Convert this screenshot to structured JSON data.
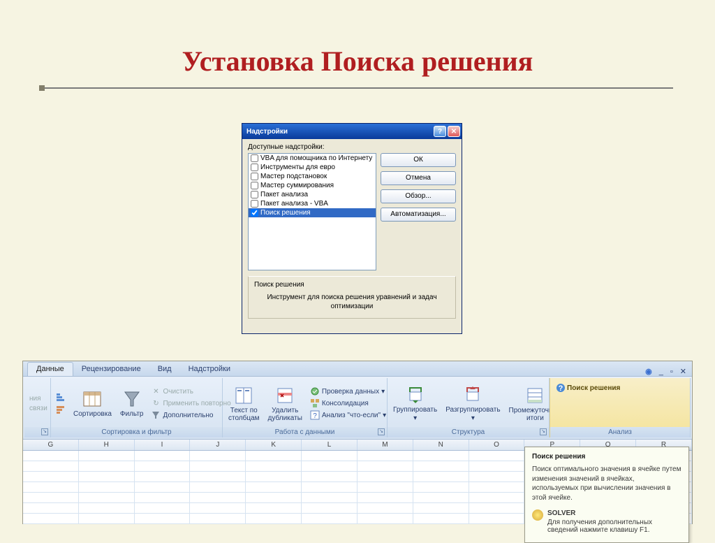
{
  "slide": {
    "title": "Установка Поиска решения"
  },
  "dialog": {
    "title": "Надстройки",
    "available_label": "Доступные надстройки:",
    "addins": [
      {
        "name": "VBA для помощника по Интернету",
        "checked": false
      },
      {
        "name": "Инструменты для евро",
        "checked": false
      },
      {
        "name": "Мастер подстановок",
        "checked": false
      },
      {
        "name": "Мастер суммирования",
        "checked": false
      },
      {
        "name": "Пакет анализа",
        "checked": false
      },
      {
        "name": "Пакет анализа - VBA",
        "checked": false
      },
      {
        "name": "Поиск решения",
        "checked": true,
        "selected": true
      }
    ],
    "buttons": {
      "ok": "ОК",
      "cancel": "Отмена",
      "browse": "Обзор...",
      "automation": "Автоматизация..."
    },
    "footer_title": "Поиск решения",
    "footer_desc": "Инструмент для поиска решения уравнений и задач оптимизации"
  },
  "ribbon": {
    "tabs": [
      "Данные",
      "Рецензирование",
      "Вид",
      "Надстройки"
    ],
    "active_tab": "Данные",
    "partial_group": {
      "items": [
        "ния",
        "связи"
      ]
    },
    "sort_group": {
      "sort": "Сортировка",
      "filter": "Фильтр",
      "clear": "Очистить",
      "reapply": "Применить повторно",
      "advanced": "Дополнительно",
      "label": "Сортировка и фильтр"
    },
    "data_tools": {
      "text_to_cols": "Текст по столбцам",
      "remove_dup": "Удалить дубликаты",
      "validation": "Проверка данных",
      "consolidate": "Консолидация",
      "whatif": "Анализ \"что-если\"",
      "label": "Работа с данными"
    },
    "outline": {
      "group": "Группировать",
      "ungroup": "Разгруппировать",
      "subtotal": "Промежуточные итоги",
      "label": "Структура"
    },
    "analysis": {
      "solver": "Поиск решения",
      "label": "Анализ"
    }
  },
  "sheet": {
    "columns": [
      "G",
      "H",
      "I",
      "J",
      "K",
      "L",
      "M",
      "N",
      "O",
      "P",
      "Q",
      "R"
    ]
  },
  "tooltip": {
    "title": "Поиск решения",
    "body": "Поиск оптимального значения в ячейке путем изменения значений в ячейках, используемых при вычислении значения в этой ячейке.",
    "solver_title": "SOLVER",
    "solver_body": "Для получения дополнительных сведений нажмите клавишу F1."
  }
}
